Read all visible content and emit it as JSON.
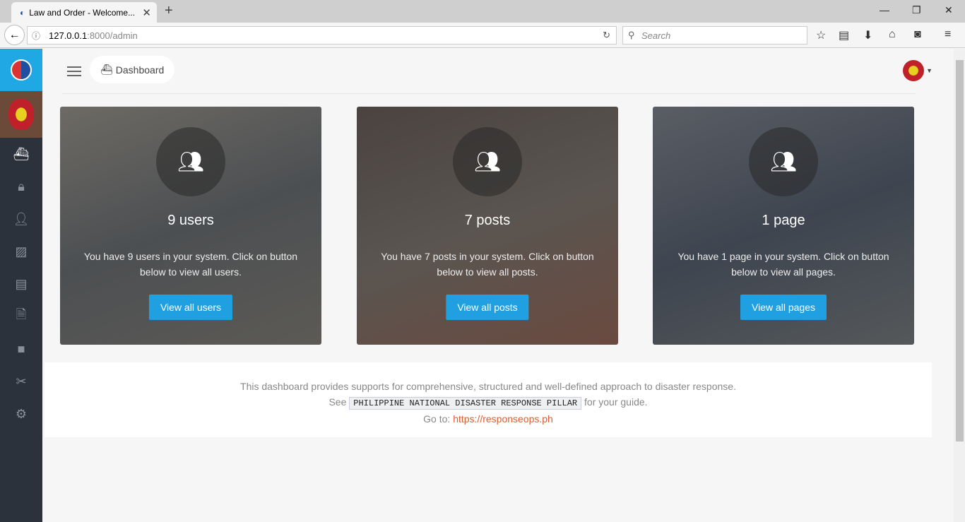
{
  "browser": {
    "tab_title": "Law and Order - Welcome...",
    "url_host": "127.0.0.1",
    "url_rest": ":8000/admin",
    "search_placeholder": "Search"
  },
  "header": {
    "breadcrumb": "Dashboard"
  },
  "sidebar": {
    "items": [
      "dashboard",
      "lock",
      "user",
      "images",
      "news",
      "file",
      "folder",
      "tools",
      "settings"
    ]
  },
  "cards": [
    {
      "count": "9 users",
      "desc": "You have 9 users in your system. Click on button below to view all users.",
      "button": "View all users"
    },
    {
      "count": "7 posts",
      "desc": "You have 7 posts in your system. Click on button below to view all posts.",
      "button": "View all posts"
    },
    {
      "count": "1 page",
      "desc": "You have 1 page in your system. Click on button below to view all pages.",
      "button": "View all pages"
    }
  ],
  "footer": {
    "line1": "This dashboard provides supports for comprehensive, structured and well-defined approach to disaster response.",
    "see": "See",
    "code": "PHILIPPINE NATIONAL DISASTER RESPONSE PILLAR",
    "guide": "for your guide.",
    "goto": "Go to:",
    "link": "https://responseops.ph"
  },
  "colors": {
    "accent": "#20a0e0",
    "sidebar": "#2b323b",
    "link": "#e25a2c"
  }
}
